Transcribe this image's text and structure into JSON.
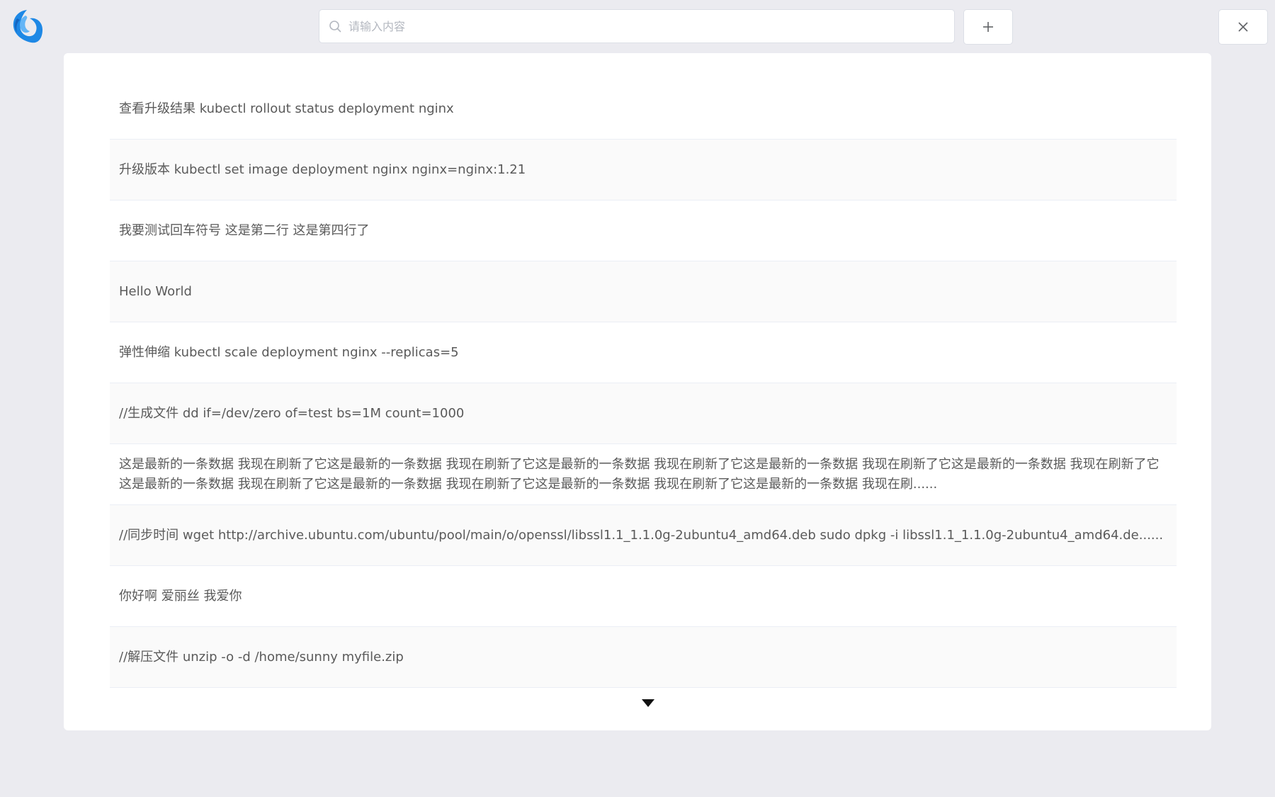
{
  "colors": {
    "background": "#ebebf0",
    "panel": "#ffffff",
    "row_alt": "#fafafa",
    "logo": "#1e88e5",
    "text": "#5a5a5a"
  },
  "header": {
    "logo_icon": "wave-logo-icon",
    "search": {
      "placeholder": "请输入内容",
      "value": "",
      "icon": "search-icon"
    },
    "add_button_icon": "plus-icon",
    "close_button_icon": "close-icon"
  },
  "list": {
    "items": [
      {
        "text": "查看升级结果 kubectl rollout status deployment nginx"
      },
      {
        "text": "升级版本 kubectl set image deployment nginx nginx=nginx:1.21"
      },
      {
        "text": "我要测试回车符号 这是第二行 这是第四行了"
      },
      {
        "text": "Hello World"
      },
      {
        "text": "弹性伸缩 kubectl scale deployment nginx --replicas=5"
      },
      {
        "text": "//生成文件 dd if=/dev/zero of=test bs=1M count=1000"
      },
      {
        "text": "这是最新的一条数据 我现在刷新了它这是最新的一条数据 我现在刷新了它这是最新的一条数据 我现在刷新了它这是最新的一条数据 我现在刷新了它这是最新的一条数据 我现在刷新了它这是最新的一条数据 我现在刷新了它这是最新的一条数据 我现在刷新了它这是最新的一条数据 我现在刷新了它这是最新的一条数据 我现在刷......"
      },
      {
        "text": "//同步时间 wget http://archive.ubuntu.com/ubuntu/pool/main/o/openssl/libssl1.1_1.1.0g-2ubuntu4_amd64.deb sudo dpkg -i libssl1.1_1.1.0g-2ubuntu4_amd64.de......"
      },
      {
        "text": "你好啊 爱丽丝 我爱你"
      },
      {
        "text": "//解压文件 unzip -o -d /home/sunny myfile.zip"
      }
    ],
    "load_more_icon": "caret-down-icon"
  }
}
